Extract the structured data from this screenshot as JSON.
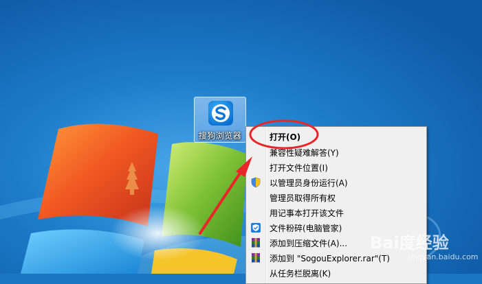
{
  "desktop": {
    "wallpaper": "windows-7-default",
    "colors": {
      "background": "#1a76c2",
      "selection": "#9cc7f2"
    }
  },
  "shortcut": {
    "label": "搜狗浏览器",
    "icon": "sogou-browser-icon"
  },
  "context_menu": {
    "items": [
      {
        "label": "打开(O)",
        "icon": null,
        "bold": true
      },
      {
        "label": "兼容性疑难解答(Y)",
        "icon": null
      },
      {
        "label": "打开文件位置(I)",
        "icon": null
      },
      {
        "label": "以管理员身份运行(A)",
        "icon": "uac-shield-icon"
      },
      {
        "label": "管理员取得所有权",
        "icon": null
      },
      {
        "label": "用记事本打开该文件",
        "icon": null
      },
      {
        "label": "文件粉碎(电脑管家)",
        "icon": "tencent-pc-manager-icon"
      },
      {
        "label": "添加到压缩文件(A)...",
        "icon": "winrar-icon"
      },
      {
        "label": "添加到 \"SogouExplorer.rar\"(T)",
        "icon": "winrar-icon"
      },
      {
        "label": "从任务栏脱离(K)",
        "icon": null
      }
    ]
  },
  "annotation": {
    "color": "#e8262a",
    "shapes": [
      "ellipse-highlight",
      "arrow"
    ]
  },
  "watermark": {
    "brand": "Bai度经验",
    "url": "jingyan.baidu.com"
  }
}
